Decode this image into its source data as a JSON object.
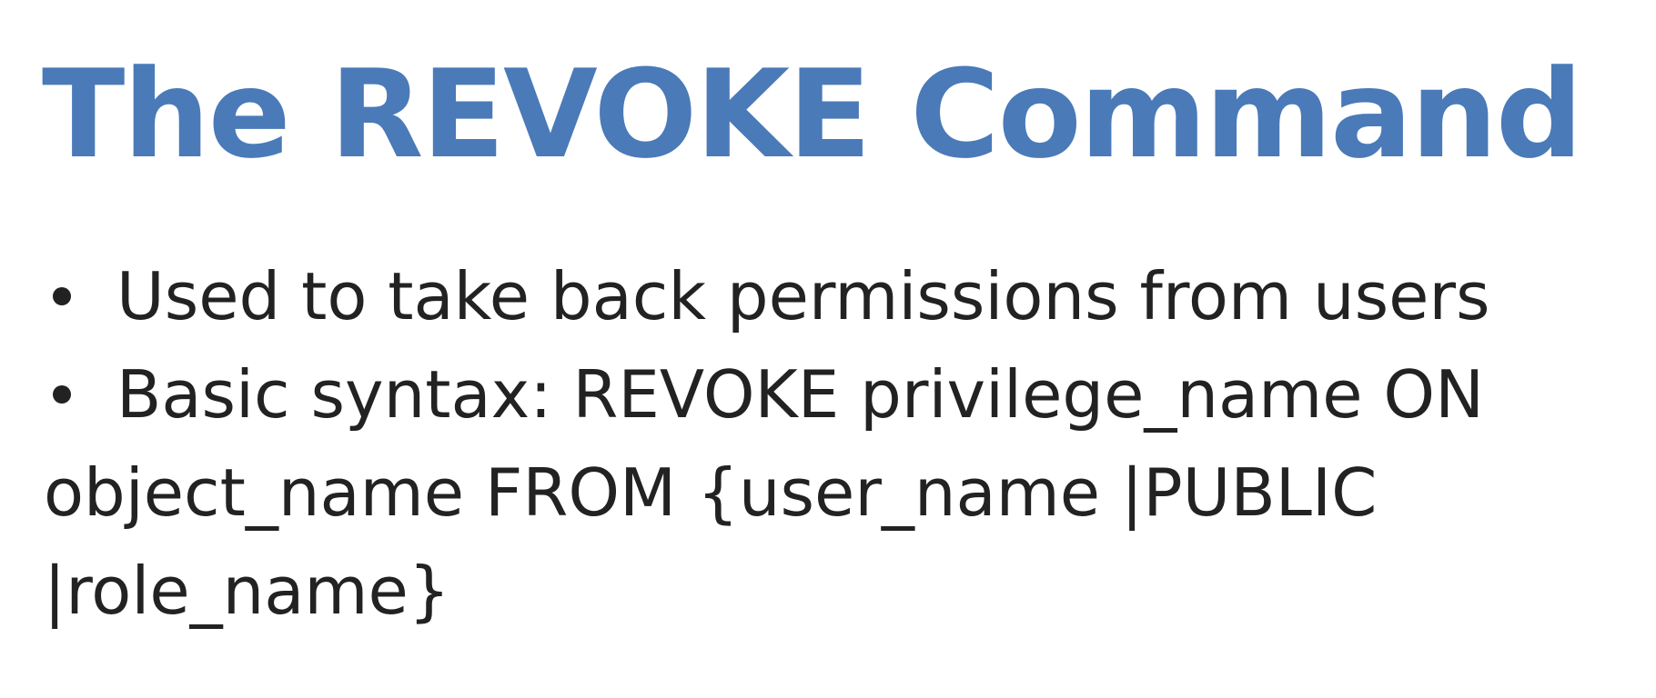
{
  "slide": {
    "title": "The REVOKE Command",
    "bullets": [
      "Used to take back permissions from users",
      "Basic syntax: REVOKE privilege_name ON object_name FROM {user_name |PUBLIC |role_name}"
    ]
  },
  "colors": {
    "title": "#4a7ab8",
    "body_text": "#222222",
    "background": "#ffffff"
  }
}
